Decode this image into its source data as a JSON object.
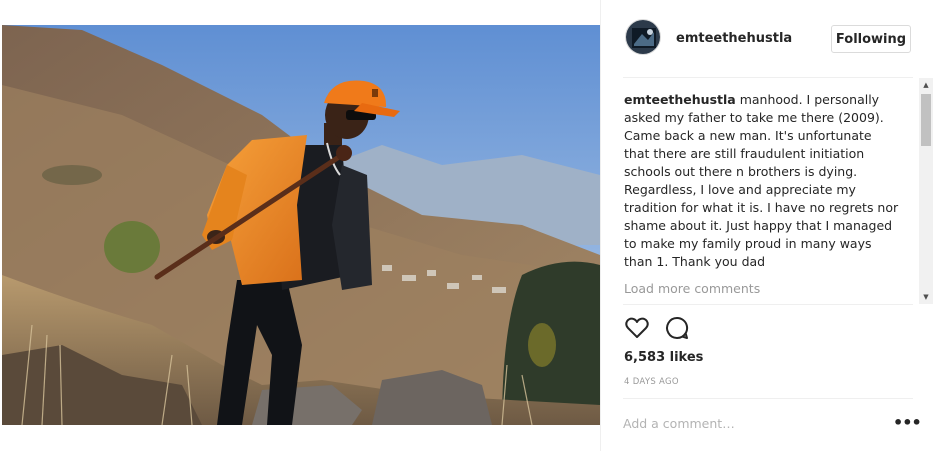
{
  "post": {
    "username": "emteethehustla",
    "follow_label": "Following",
    "caption_user": "emteethehustla",
    "caption_text": "manhood. I personally asked my father to take me there (2009). Came back a new man. It's unfortunate that there are still fraudulent initiation schools out there n brothers is dying. Regardless, I love and appreciate my tradition for what it is. I have no regrets nor shame about it. Just happy that I managed to make my family proud in many ways than 1. Thank you dad",
    "load_more_label": "Load more comments",
    "likes": "6,583 likes",
    "timestamp": "4 DAYS AGO",
    "comment_placeholder": "Add a comment…",
    "more_options_glyph": "•••"
  },
  "icons": {
    "like": "heart-outline-icon",
    "comment": "speech-bubble-icon",
    "more": "ellipsis-icon",
    "scroll_up": "triangle-up-icon",
    "scroll_down": "triangle-down-icon"
  },
  "photo": {
    "subject": "man in orange jacket and orange cap holding a wooden stick on a rocky hillside",
    "colors": {
      "sky": "#7fa6d9",
      "hill": "#8a7158",
      "jacket": "#ef8a1f",
      "cap": "#f07a1a"
    }
  },
  "theme": {
    "link_gray": "#999999",
    "border": "#dbdbdb",
    "text": "#262626"
  }
}
